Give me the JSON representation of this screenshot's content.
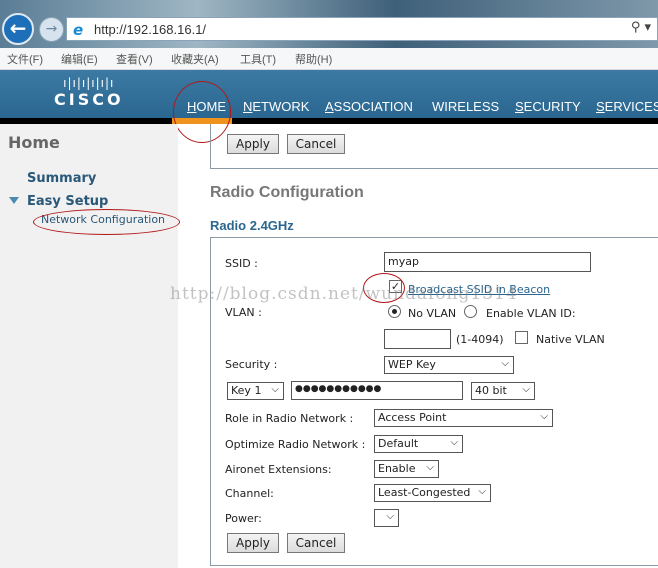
{
  "browser": {
    "url": "http://192.168.16.1/",
    "search_icon": "search-icon",
    "back_icon": "arrow-left-icon",
    "forward_icon": "arrow-right-icon",
    "menu": [
      "文件(F)",
      "编辑(E)",
      "查看(V)",
      "收藏夹(A)",
      "工具(T)",
      "帮助(H)"
    ]
  },
  "header": {
    "logo": "CISCO",
    "logo_bars": "ı|ı|ı|ı|ı|ı",
    "nav": [
      {
        "first": "H",
        "rest": "OME",
        "active": true
      },
      {
        "first": "N",
        "rest": "ETWORK"
      },
      {
        "first": "A",
        "rest": "SSOCIATION"
      },
      {
        "first": "WI",
        "rest": "RELESS",
        "u": "I"
      },
      {
        "first": "S",
        "rest": "ECURITY"
      },
      {
        "first": "S",
        "rest": "ERVICES"
      }
    ],
    "accent": "#f0921e"
  },
  "sidebar": {
    "title": "Home",
    "items": [
      {
        "label": "Summary"
      },
      {
        "label": "Easy Setup",
        "expanded": true
      }
    ],
    "sub_item": "Network Configuration"
  },
  "main": {
    "apply": "Apply",
    "cancel": "Cancel",
    "title": "Radio Configuration",
    "section": "Radio 2.4GHz",
    "ssid_label": "SSID :",
    "ssid": "myap",
    "broadcast_label": "Broadcast SSID in Beacon",
    "broadcast_checked": true,
    "vlan_label": "VLAN :",
    "no_vlan": "No VLAN",
    "enable_vlan": "Enable VLAN ID:",
    "vlan_selected": "No VLAN",
    "vlan_id": "",
    "vlan_range": "(1-4094)",
    "native_vlan": "Native VLAN",
    "native_vlan_checked": false,
    "security_label": "Security :",
    "security": "WEP Key",
    "key_index": "Key 1",
    "key_value": "●●●●●●●●●●●",
    "key_size": "40 bit",
    "role_label": "Role in Radio Network :",
    "role": "Access Point",
    "optimize_label": "Optimize Radio Network :",
    "optimize": "Default",
    "aironet_label": "Aironet Extensions:",
    "aironet": "Enable",
    "channel_label": "Channel:",
    "channel": "Least-Congested",
    "power_label": "Power:",
    "power": ""
  },
  "watermark": "http://blog.csdn.net/wundafong1314"
}
